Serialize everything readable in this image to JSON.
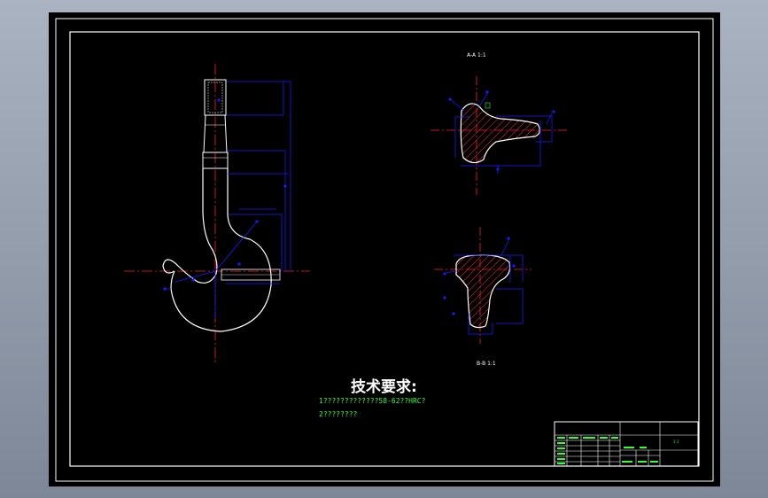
{
  "drawing": {
    "section_labels": {
      "section_aa": "A-A 1:1",
      "section_bb": "B-B 1:1"
    },
    "requirements": {
      "heading": "技术要求:",
      "line1": "1?????????????58-62??HRC?",
      "line2": "2????????"
    },
    "title_block": {
      "scale_cell": "1:1"
    },
    "colors": {
      "background": "#000000",
      "outline": "#ffffff",
      "dimension": "#1a1aff",
      "centerline": "#ff2020",
      "hatch": "#ff3030",
      "text_green": "#33ff33",
      "window_bg": "#a9b3c1"
    }
  }
}
